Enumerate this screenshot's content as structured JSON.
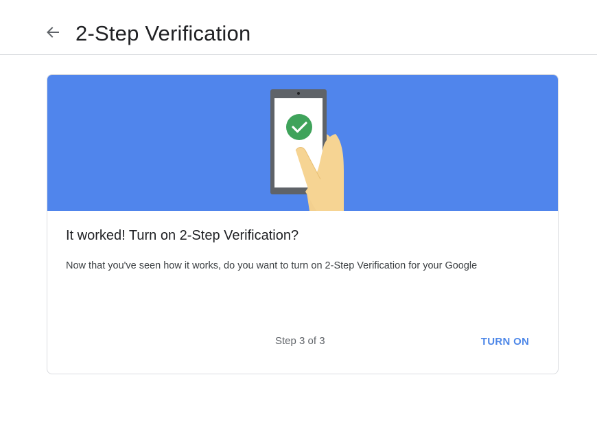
{
  "header": {
    "title": "2-Step Verification",
    "back_icon": "arrow-back-icon"
  },
  "card": {
    "banner_illustration": "phone-check-icon",
    "heading": "It worked! Turn on 2-Step Verification?",
    "body": "Now that you've seen how it works, do you want to turn on 2-Step Verification for your Google",
    "step": "Step 3 of 3",
    "turn_on_label": "TURN ON"
  },
  "colors": {
    "banner": "#5085ec",
    "check": "#3fa35b",
    "accent": "#4d87e8"
  }
}
